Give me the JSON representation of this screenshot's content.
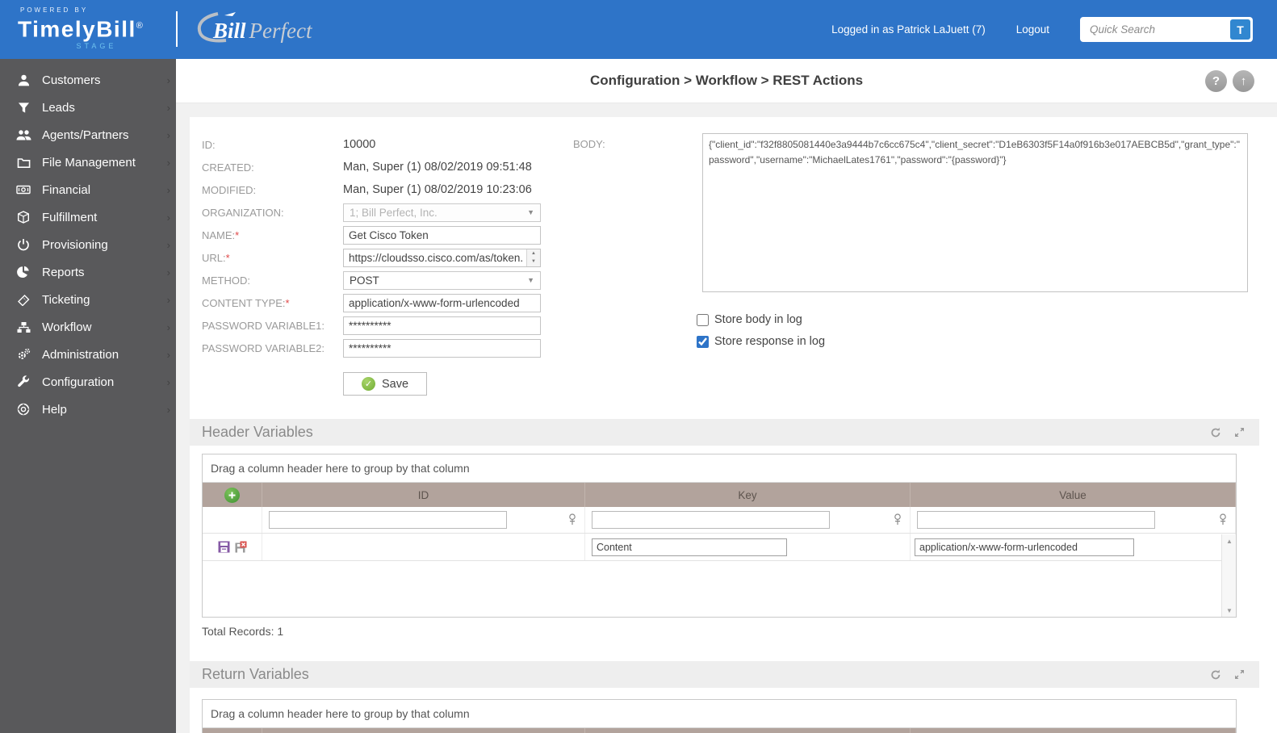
{
  "colors": {
    "header_blue": "#2e74c8",
    "sidebar_gray": "#59595b",
    "grid_header_tan": "#b2a39c",
    "accent_green": "#71ad34",
    "stage_blue": "#6fc2ee"
  },
  "header": {
    "powered_by": "POWERED BY",
    "brand": "TimelyBill",
    "brand_reg": "®",
    "environment": "STAGE",
    "partner_bill": "Bill",
    "partner_perfect": "Perfect",
    "logged_in": "Logged in as Patrick LaJuett (7)",
    "logout": "Logout",
    "search_placeholder": "Quick Search",
    "search_button": "T"
  },
  "sidebar": {
    "items": [
      {
        "label": "Customers",
        "icon": "user-icon"
      },
      {
        "label": "Leads",
        "icon": "filter-icon"
      },
      {
        "label": "Agents/Partners",
        "icon": "users-icon"
      },
      {
        "label": "File Management",
        "icon": "folder-icon"
      },
      {
        "label": "Financial",
        "icon": "money-icon"
      },
      {
        "label": "Fulfillment",
        "icon": "box-icon"
      },
      {
        "label": "Provisioning",
        "icon": "power-icon"
      },
      {
        "label": "Reports",
        "icon": "pie-chart-icon"
      },
      {
        "label": "Ticketing",
        "icon": "ticket-icon"
      },
      {
        "label": "Workflow",
        "icon": "sitemap-icon"
      },
      {
        "label": "Administration",
        "icon": "gears-icon"
      },
      {
        "label": "Configuration",
        "icon": "wrench-icon"
      },
      {
        "label": "Help",
        "icon": "life-ring-icon"
      }
    ]
  },
  "breadcrumb": "Configuration > Workflow > REST Actions",
  "form": {
    "required_marker": "*",
    "id_label": "ID:",
    "id_value": "10000",
    "created_label": "CREATED:",
    "created_value": "Man, Super (1) 08/02/2019 09:51:48",
    "modified_label": "MODIFIED:",
    "modified_value": "Man, Super (1) 08/02/2019 10:23:06",
    "organization_label": "ORGANIZATION:",
    "organization_value": "1; Bill Perfect, Inc.",
    "name_label": "NAME:",
    "name_value": "Get Cisco Token",
    "url_label": "URL:",
    "url_value": "https://cloudsso.cisco.com/as/token.",
    "method_label": "METHOD:",
    "method_value": "POST",
    "content_type_label": "CONTENT TYPE:",
    "content_type_value": "application/x-www-form-urlencoded",
    "password1_label": "PASSWORD VARIABLE1:",
    "password1_value": "**********",
    "password2_label": "PASSWORD VARIABLE2:",
    "password2_value": "**********",
    "body_label": "BODY:",
    "body_value": "{\"client_id\":\"f32f8805081440e3a9444b7c6cc675c4\",\"client_secret\":\"D1eB6303f5F14a0f916b3e017AEBCB5d\",\"grant_type\":\"password\",\"username\":\"MichaelLates1761\",\"password\":\"{password}\"}",
    "store_body_label": "Store body in log",
    "store_body_checked": false,
    "store_response_label": "Store response in log",
    "store_response_checked": true,
    "save_label": "Save"
  },
  "header_variables": {
    "title": "Header Variables",
    "group_hint": "Drag a column header here to group by that column",
    "columns": [
      "ID",
      "Key",
      "Value"
    ],
    "rows": [
      {
        "id": "",
        "key": "Content",
        "value": "application/x-www-form-urlencoded"
      }
    ],
    "total_records": "Total Records: 1"
  },
  "return_variables": {
    "title": "Return Variables",
    "group_hint": "Drag a column header here to group by that column"
  }
}
